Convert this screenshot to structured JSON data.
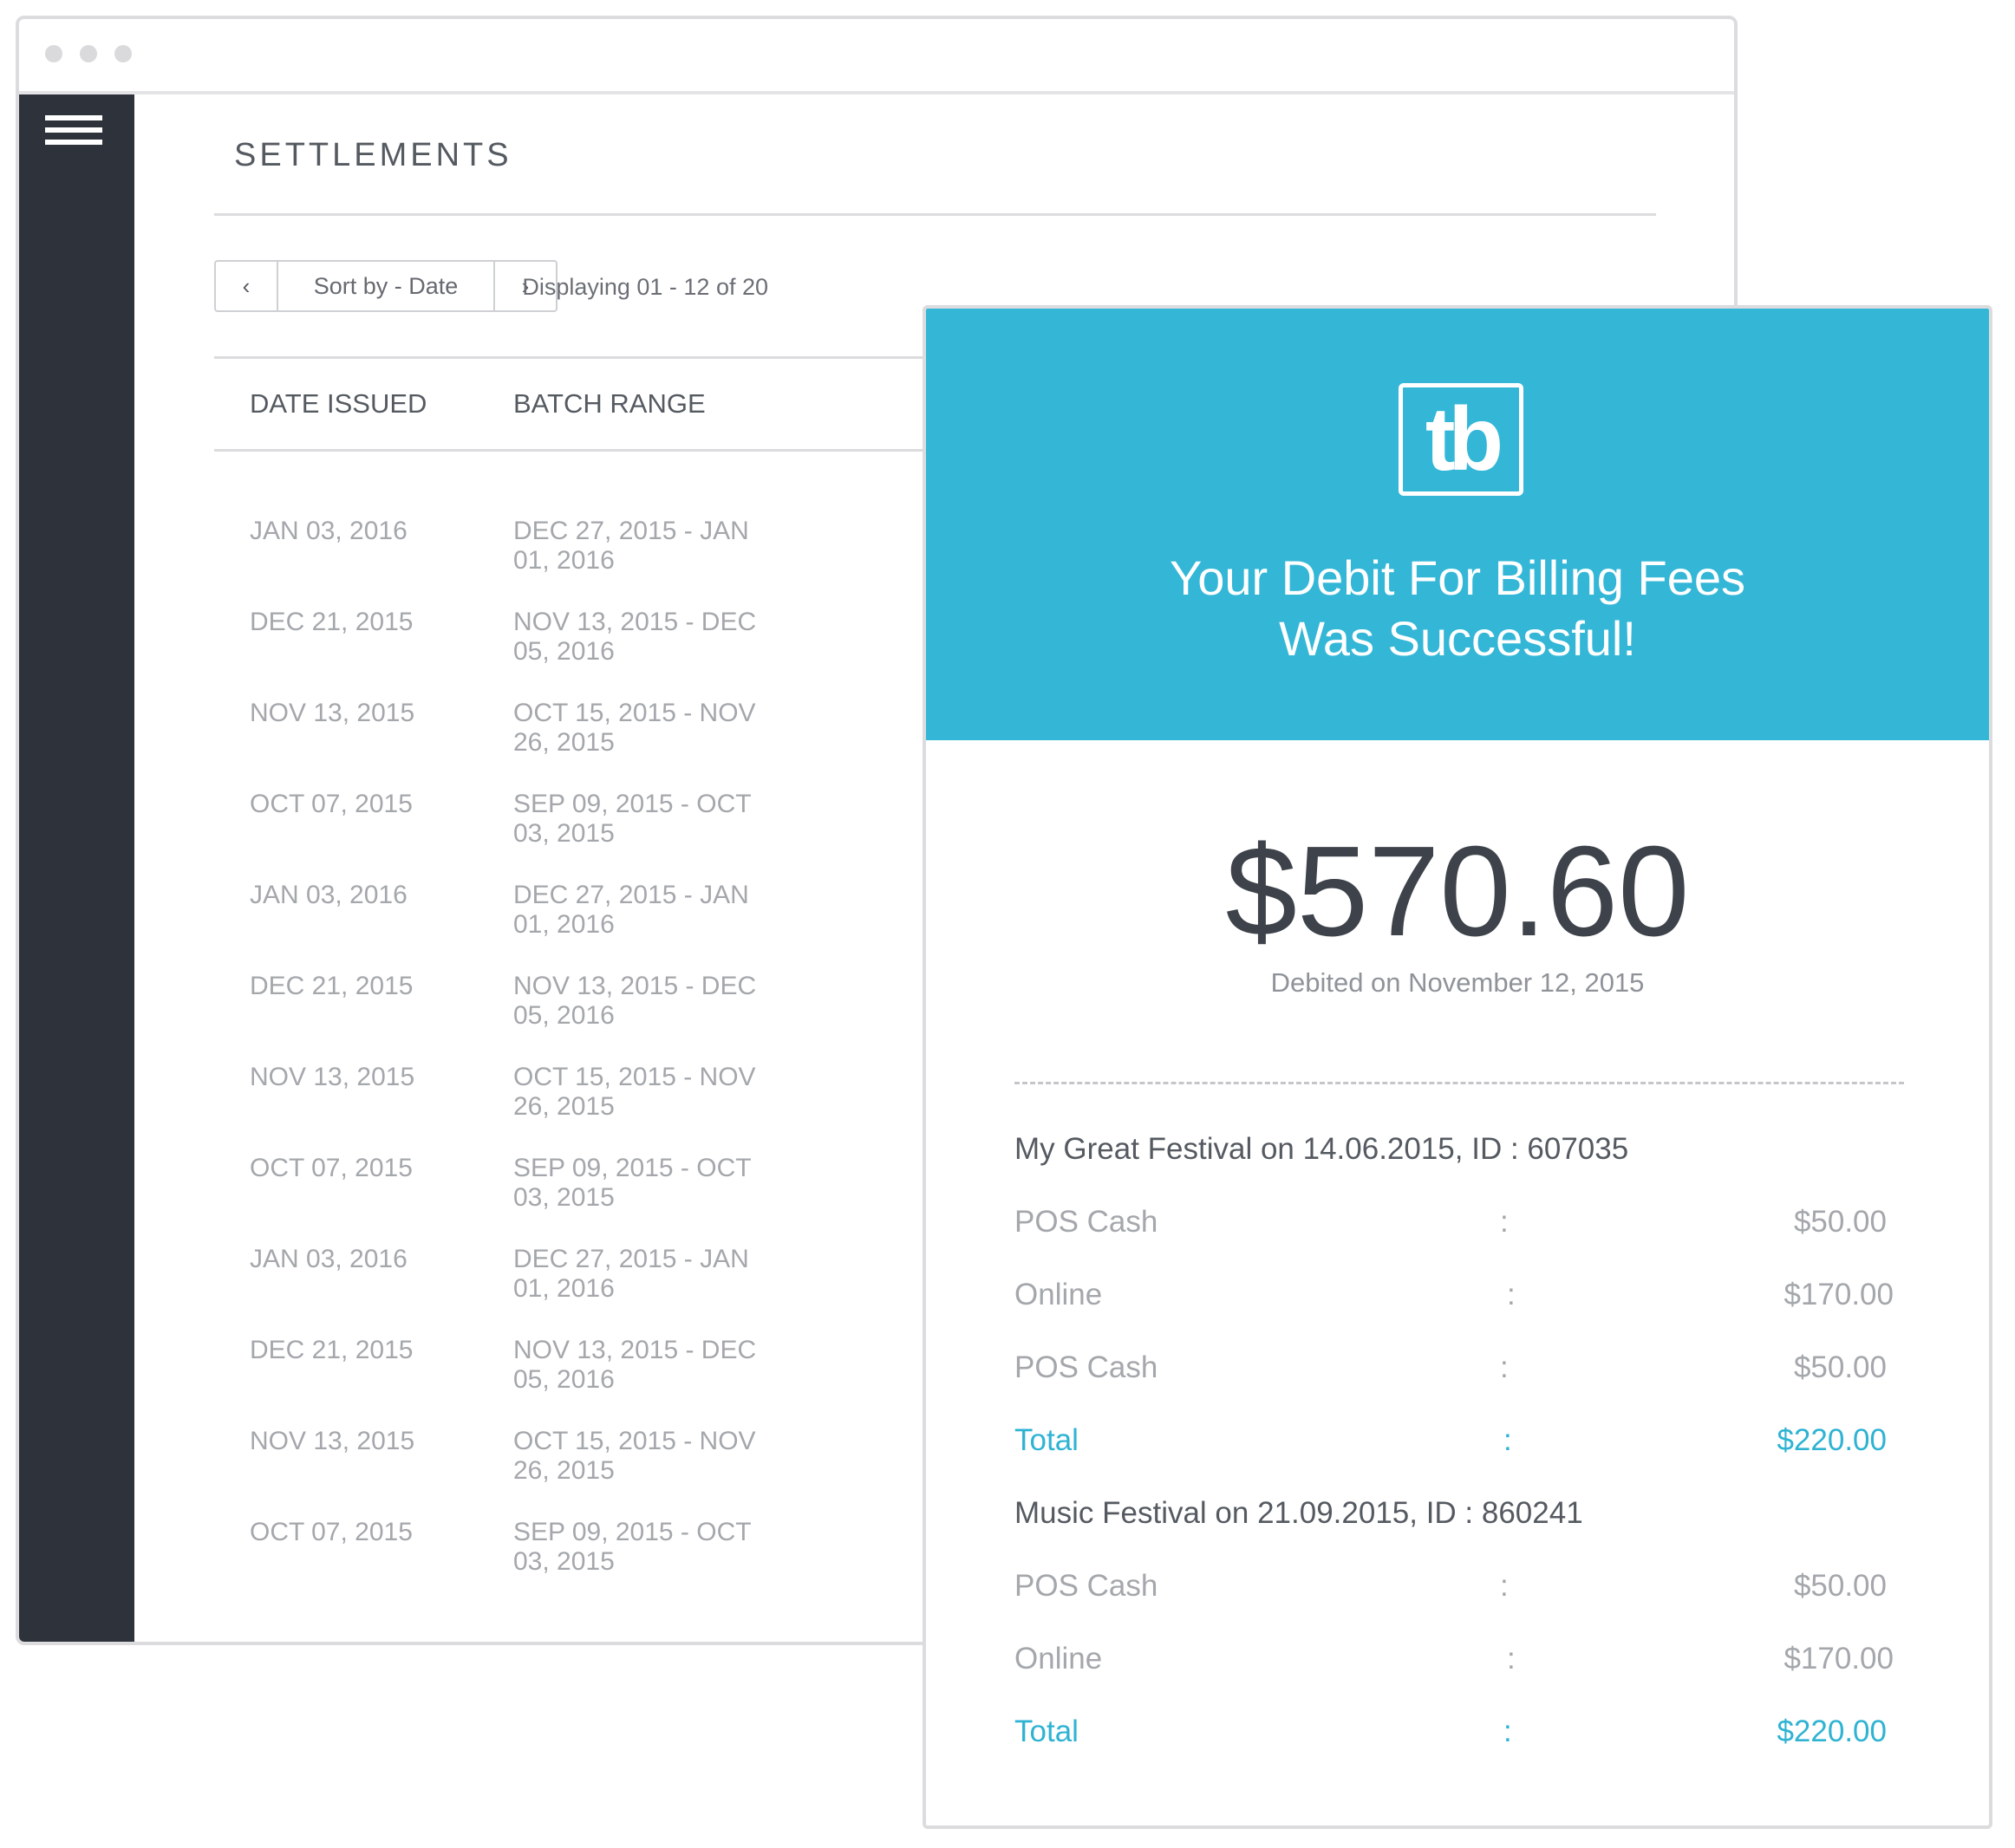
{
  "window": {
    "title": "SETTLEMENTS"
  },
  "toolbar": {
    "prev_icon": "chevron-left-icon",
    "next_icon": "chevron-right-icon",
    "prev_glyph": "‹",
    "next_glyph": "›",
    "sort_label": "Sort by - Date",
    "displaying": "Displaying 01 - 12 of 20"
  },
  "table": {
    "headers": [
      "DATE ISSUED",
      "BATCH RANGE"
    ],
    "rows": [
      {
        "date": "JAN 03, 2016",
        "range": "DEC 27, 2015 - JAN 01, 2016"
      },
      {
        "date": "DEC 21, 2015",
        "range": "NOV 13, 2015 - DEC 05, 2016"
      },
      {
        "date": "NOV 13, 2015",
        "range": "OCT 15, 2015 - NOV 26, 2015"
      },
      {
        "date": "OCT 07, 2015",
        "range": "SEP 09, 2015 - OCT 03, 2015"
      },
      {
        "date": "JAN 03, 2016",
        "range": "DEC 27, 2015 - JAN 01, 2016"
      },
      {
        "date": "DEC 21, 2015",
        "range": "NOV 13, 2015 - DEC 05, 2016"
      },
      {
        "date": "NOV 13, 2015",
        "range": "OCT 15, 2015 - NOV 26, 2015"
      },
      {
        "date": "OCT 07, 2015",
        "range": "SEP 09, 2015 - OCT 03, 2015"
      },
      {
        "date": "JAN 03, 2016",
        "range": "DEC 27, 2015 - JAN 01, 2016"
      },
      {
        "date": "DEC 21, 2015",
        "range": "NOV 13, 2015 - DEC 05, 2016"
      },
      {
        "date": "NOV 13, 2015",
        "range": "OCT 15, 2015 - NOV 26, 2015"
      },
      {
        "date": "OCT 07, 2015",
        "range": "SEP 09, 2015 - OCT 03, 2015"
      }
    ]
  },
  "receipt": {
    "logo_text": "tb",
    "headline_1": "Your Debit  For Billing Fees",
    "headline_2": "Was  Successful!",
    "amount": "$570.60",
    "debited_on": "Debited on November 12, 2015",
    "colors": {
      "accent": "#34b7d7",
      "total": "#2fb3d3",
      "sidebar": "#2e333b"
    },
    "events": [
      {
        "title": "My Great Festival on 14.06.2015, ID : 607035",
        "lines": [
          {
            "label": "POS Cash",
            "colon": ":",
            "amount": "$50.00"
          },
          {
            "label": "Online",
            "colon": ":",
            "amount": "$170.00"
          },
          {
            "label": "POS Cash",
            "colon": ":",
            "amount": "$50.00"
          }
        ],
        "total": {
          "label": "Total",
          "colon": ":",
          "amount": "$220.00"
        }
      },
      {
        "title": "Music Festival on 21.09.2015, ID : 860241",
        "lines": [
          {
            "label": "POS Cash",
            "colon": ":",
            "amount": "$50.00"
          },
          {
            "label": "Online",
            "colon": ":",
            "amount": "$170.00"
          }
        ],
        "total": {
          "label": "Total",
          "colon": ":",
          "amount": "$220.00"
        }
      }
    ]
  }
}
